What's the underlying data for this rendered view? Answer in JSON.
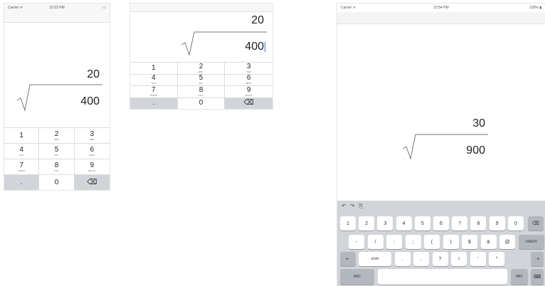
{
  "phone": {
    "status": {
      "carrier": "Carrier ᯤ",
      "time": "10:53 PM",
      "battery": "▭"
    },
    "result": "20",
    "radicand": "400"
  },
  "landscape": {
    "result": "20",
    "radicand": "400"
  },
  "tablet": {
    "status": {
      "carrier": "Carrier ᯤ",
      "time": "10:54 PM",
      "battery": "100% ▮"
    },
    "result": "30",
    "radicand": "900",
    "toolbar": {
      "undo": "↶",
      "redo": "↷",
      "paste": "⎘"
    },
    "row1": [
      "1",
      "2",
      "3",
      "4",
      "5",
      "6",
      "7",
      "8",
      "9",
      "0"
    ],
    "row2": [
      "-",
      "/",
      ":",
      ";",
      "(",
      ")",
      "$",
      "&",
      "@"
    ],
    "row2_return": "return",
    "row3": [
      "undo",
      ".",
      ",",
      "?",
      "!",
      "'",
      "\""
    ],
    "row4_abc": "ABC",
    "row4_abc_right": "ABC"
  },
  "keypad": [
    {
      "d": "1",
      "l": ""
    },
    {
      "d": "2",
      "l": "ABC"
    },
    {
      "d": "3",
      "l": "DEF"
    },
    {
      "d": "4",
      "l": "GHI"
    },
    {
      "d": "5",
      "l": "JKL"
    },
    {
      "d": "6",
      "l": "MNO"
    },
    {
      "d": "7",
      "l": "PQRS"
    },
    {
      "d": "8",
      "l": "TUV"
    },
    {
      "d": "9",
      "l": "WXYZ"
    },
    {
      "d": ".",
      "l": ""
    },
    {
      "d": "0",
      "l": ""
    },
    {
      "d": "⌫",
      "l": ""
    }
  ]
}
